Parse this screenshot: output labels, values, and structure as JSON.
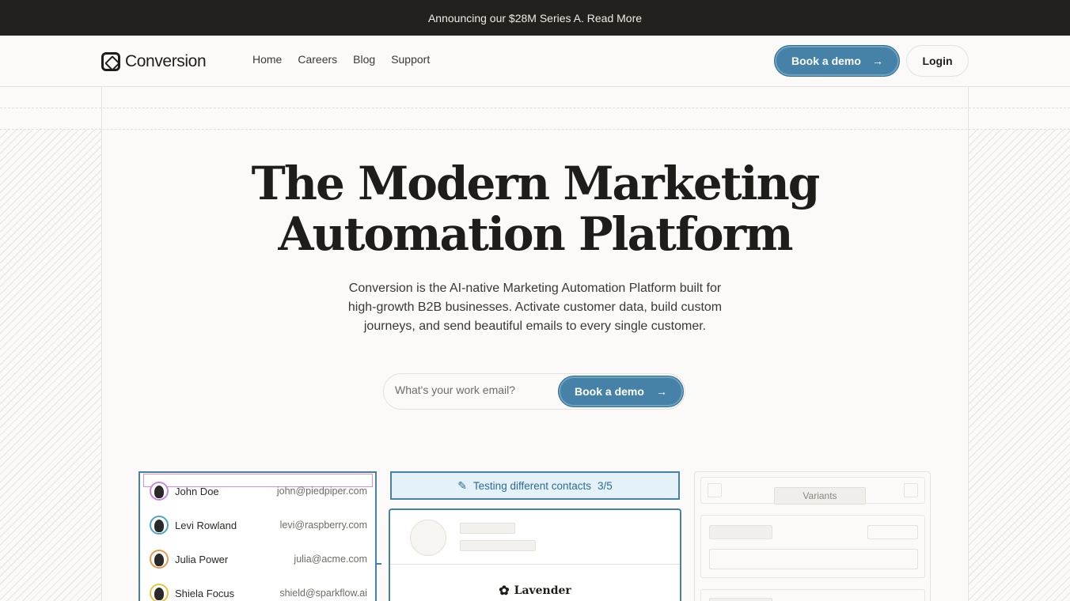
{
  "announcement": {
    "text": "Announcing our $28M Series A. Read More"
  },
  "nav": {
    "brand": "Conversion",
    "links": [
      "Home",
      "Careers",
      "Blog",
      "Support"
    ],
    "demo_label": "Book a demo",
    "login_label": "Login"
  },
  "hero": {
    "title_line1": "The Modern Marketing",
    "title_line2": "Automation Platform",
    "subtitle": "Conversion is the AI-native Marketing Automation Platform built for high-growth B2B businesses. Activate customer data, build custom journeys, and send beautiful emails to every single customer.",
    "email_placeholder": "What's your work email?",
    "cta_label": "Book a demo"
  },
  "preview": {
    "contacts": [
      {
        "name": "John Doe",
        "email": "john@piedpiper.com",
        "ring": "#c98ad6"
      },
      {
        "name": "Levi Rowland",
        "email": "levi@raspberry.com",
        "ring": "#4fa3cf"
      },
      {
        "name": "Julia Power",
        "email": "julia@acme.com",
        "ring": "#e79a4b"
      },
      {
        "name": "Shiela Focus",
        "email": "shield@sparkflow.ai",
        "ring": "#e8c63c"
      }
    ],
    "testing_label": "Testing different contacts",
    "testing_count": "3/5",
    "email_brand": "Lavender",
    "variants_label": "Variants"
  }
}
